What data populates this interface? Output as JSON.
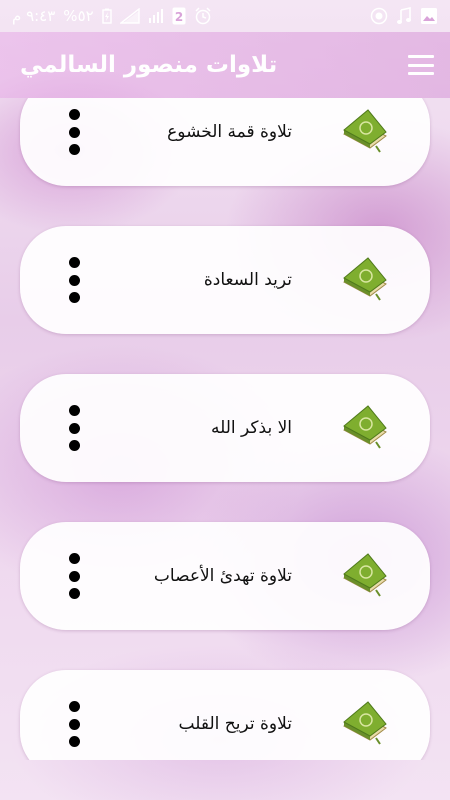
{
  "status_bar": {
    "time": "٩:٤٣ م",
    "battery": "%٥٢",
    "sim_badge": "2",
    "left_icons": [
      "time",
      "battery-icon",
      "signal-icon",
      "signal-icon",
      "sim-icon",
      "alarm-icon"
    ],
    "right_icons": [
      "gallery-icon",
      "music-icon",
      "record-icon"
    ]
  },
  "app_bar": {
    "title": "تلاوات منصور السالمي",
    "menu_icon": "hamburger-menu-icon"
  },
  "items": [
    {
      "label": "تلاوة قمة الخشوع"
    },
    {
      "label": "تريد السعادة"
    },
    {
      "label": "الا بذكر الله"
    },
    {
      "label": "تلاوة تهدئ الأعصاب"
    },
    {
      "label": "تلاوة تريح القلب"
    }
  ],
  "colors": {
    "accent": "#d99ad9",
    "card": "#ffffff",
    "book_green": "#6a9a2a",
    "text": "#111111"
  }
}
